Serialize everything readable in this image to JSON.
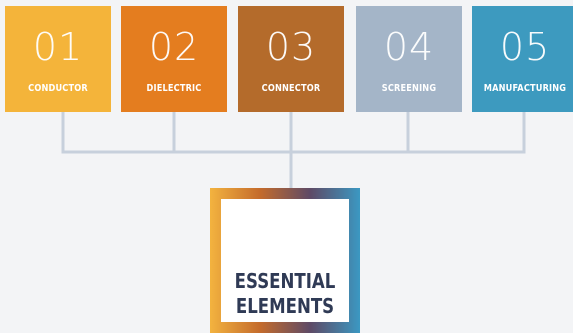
{
  "tiles": [
    {
      "number": "01",
      "label": "CONDUCTOR",
      "color": "#f4b43a"
    },
    {
      "number": "02",
      "label": "DIELECTRIC",
      "color": "#e47d1f"
    },
    {
      "number": "03",
      "label": "CONNECTOR",
      "color": "#b46b2b"
    },
    {
      "number": "04",
      "label": "SCREENING",
      "color": "#a4b5c8"
    },
    {
      "number": "05",
      "label": "MANUFACTURING",
      "color": "#3d9abf"
    }
  ],
  "center": {
    "title": "ESSENTIAL\nELEMENTS",
    "frame_gradient": [
      "#f3b33f",
      "#c46b2c",
      "#5e4a66",
      "#3b98c2"
    ]
  },
  "colors": {
    "background": "#f3f4f6",
    "connector_line": "#c7d0dc",
    "title_text": "#2f3a55"
  }
}
